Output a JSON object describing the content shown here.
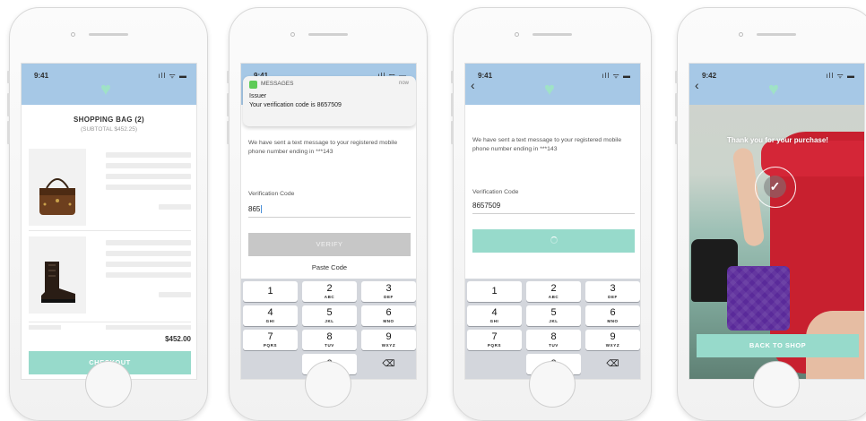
{
  "colors": {
    "status_bar": "#a6c8e6",
    "heart": "#9fe2c6",
    "accent_button": "#97dacb",
    "disabled_button": "#c7c7c7",
    "keypad_bg": "#d3d6dc"
  },
  "icons": {
    "heart": "♥",
    "back": "‹",
    "signal": "ıll ᯤ ▬",
    "check": "✓",
    "backspace": "⌫"
  },
  "screen1": {
    "time": "9:41",
    "title": "SHOPPING BAG (2)",
    "subtotal": "(SUBTOTAL $452.25)",
    "items": [
      {
        "image": "handbag-icon"
      },
      {
        "image": "boot-icon"
      }
    ],
    "total": "$452.00",
    "checkout_label": "CHECKOUT"
  },
  "screen2": {
    "time": "9:41",
    "notification": {
      "app": "MESSAGES",
      "time": "now",
      "sender": "Issuer",
      "message": "Your verification code is 8657509"
    },
    "body": "We have sent a text message to your registered mobile phone number ending in ***143",
    "field_label": "Verification Code",
    "field_value": "865",
    "verify_label": "VERIFY",
    "paste_label": "Paste Code"
  },
  "screen3": {
    "time": "9:41",
    "body": "We have sent a text message to your registered mobile phone number ending in ***143",
    "field_label": "Verification Code",
    "field_value": "8657509"
  },
  "screen4": {
    "time": "9:42",
    "thanks": "Thank you for your purchase!",
    "back_label": "BACK TO SHOP"
  },
  "keypad": {
    "keys": [
      {
        "num": "1",
        "letters": ""
      },
      {
        "num": "2",
        "letters": "ABC"
      },
      {
        "num": "3",
        "letters": "DEF"
      },
      {
        "num": "4",
        "letters": "GHI"
      },
      {
        "num": "5",
        "letters": "JKL"
      },
      {
        "num": "6",
        "letters": "MNO"
      },
      {
        "num": "7",
        "letters": "PQRS"
      },
      {
        "num": "8",
        "letters": "TUV"
      },
      {
        "num": "9",
        "letters": "WXYZ"
      },
      {
        "num": "0",
        "letters": ""
      }
    ]
  }
}
